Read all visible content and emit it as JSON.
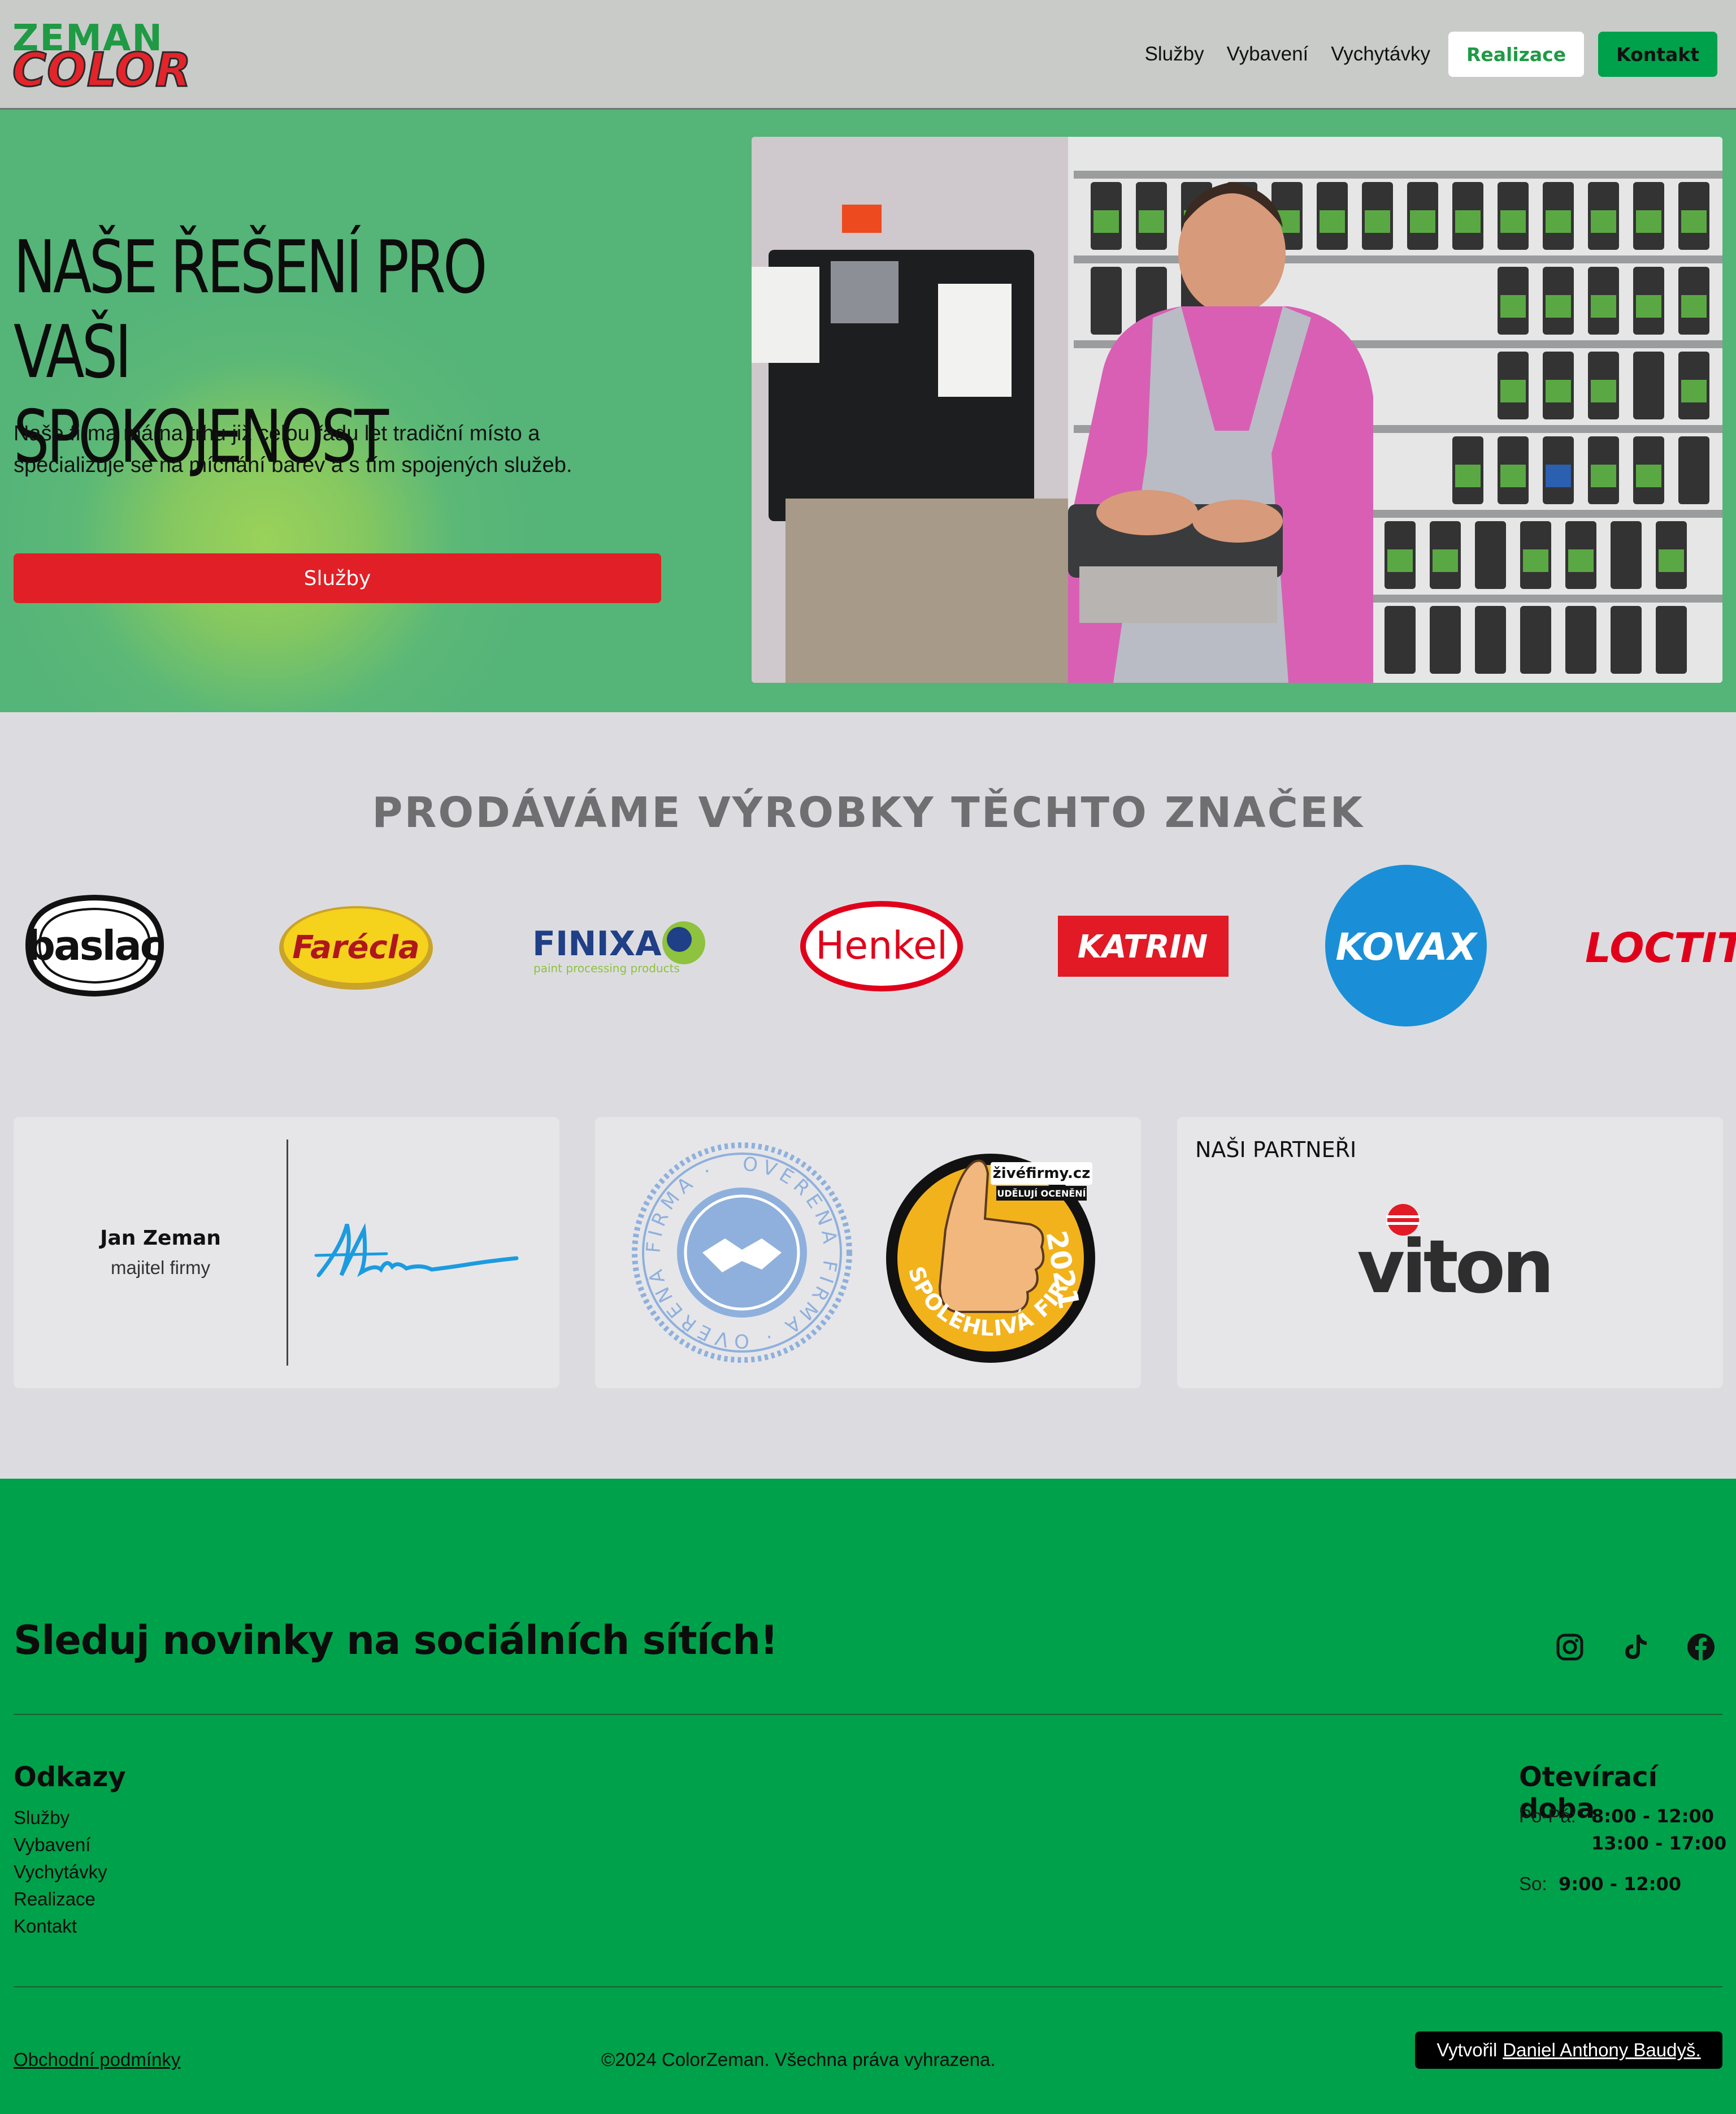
{
  "header": {
    "logo_line1": "ZEMAN",
    "logo_line2": "COLOR",
    "nav": [
      "Služby",
      "Vybavení",
      "Vychytávky"
    ],
    "btn_realizace": "Realizace",
    "btn_kontakt": "Kontakt"
  },
  "hero": {
    "title_line1": "NAŠE ŘEŠENÍ PRO VAŠI",
    "title_line2": "SPOKOJENOST",
    "subtitle_line1": "Naše firma má na trhu již celou řadu let tradiční místo a",
    "subtitle_line2": "specializuje se na míchání barev a s tím spojených služeb.",
    "cta": "Služby"
  },
  "brands": {
    "title": "PRODÁVÁME VÝROBKY TĚCHTO ZNAČEK",
    "items": [
      "baslac",
      "Farécla",
      "FINIXA",
      "Henkel",
      "KATRIN",
      "KOVAX",
      "LOCTITE"
    ],
    "finixa_tagline": "paint processing products"
  },
  "cards": {
    "owner_name": "Jan Zeman",
    "owner_role": "majitel firmy",
    "badge1_text": "OVĚŘENÁ FIRMA · OVĚŘENÁ FIRMA ·",
    "badge2_top": "živéfirmy.cz",
    "badge2_sub": "UDĚLUJÍ OCENĚNÍ",
    "badge2_year": "2021",
    "badge2_bottom": "SPOLEHLIVÁ FIRMA",
    "partners_title": "NAŠI PARTNEŘI",
    "partner": "viton"
  },
  "footer": {
    "social_title": "Sleduj novinky na sociálních sítích!",
    "links_title": "Odkazy",
    "links": [
      "Služby",
      "Vybavení",
      "Vychytávky",
      "Realizace",
      "Kontakt"
    ],
    "hours_title": "Otevírací doba",
    "weekdays_label": "Po-Pá:",
    "weekdays_1": "8:00 - 12:00",
    "weekdays_2": "13:00 - 17:00",
    "sat_label": "So:",
    "sat_hours": "9:00 - 12:00",
    "terms": "Obchodní podmínky",
    "copyright": "©2024 ColorZeman. Všechna práva vyhrazena.",
    "credit_prefix": "Vytvořil",
    "credit_name": "Daniel Anthony Baudyš."
  },
  "colors": {
    "brand_green": "#00a14b",
    "brand_red": "#e11f26",
    "header_bg": "#c9cbc9",
    "section_bg": "#dcdce0"
  },
  "icons": [
    "instagram-icon",
    "tiktok-icon",
    "facebook-icon"
  ]
}
